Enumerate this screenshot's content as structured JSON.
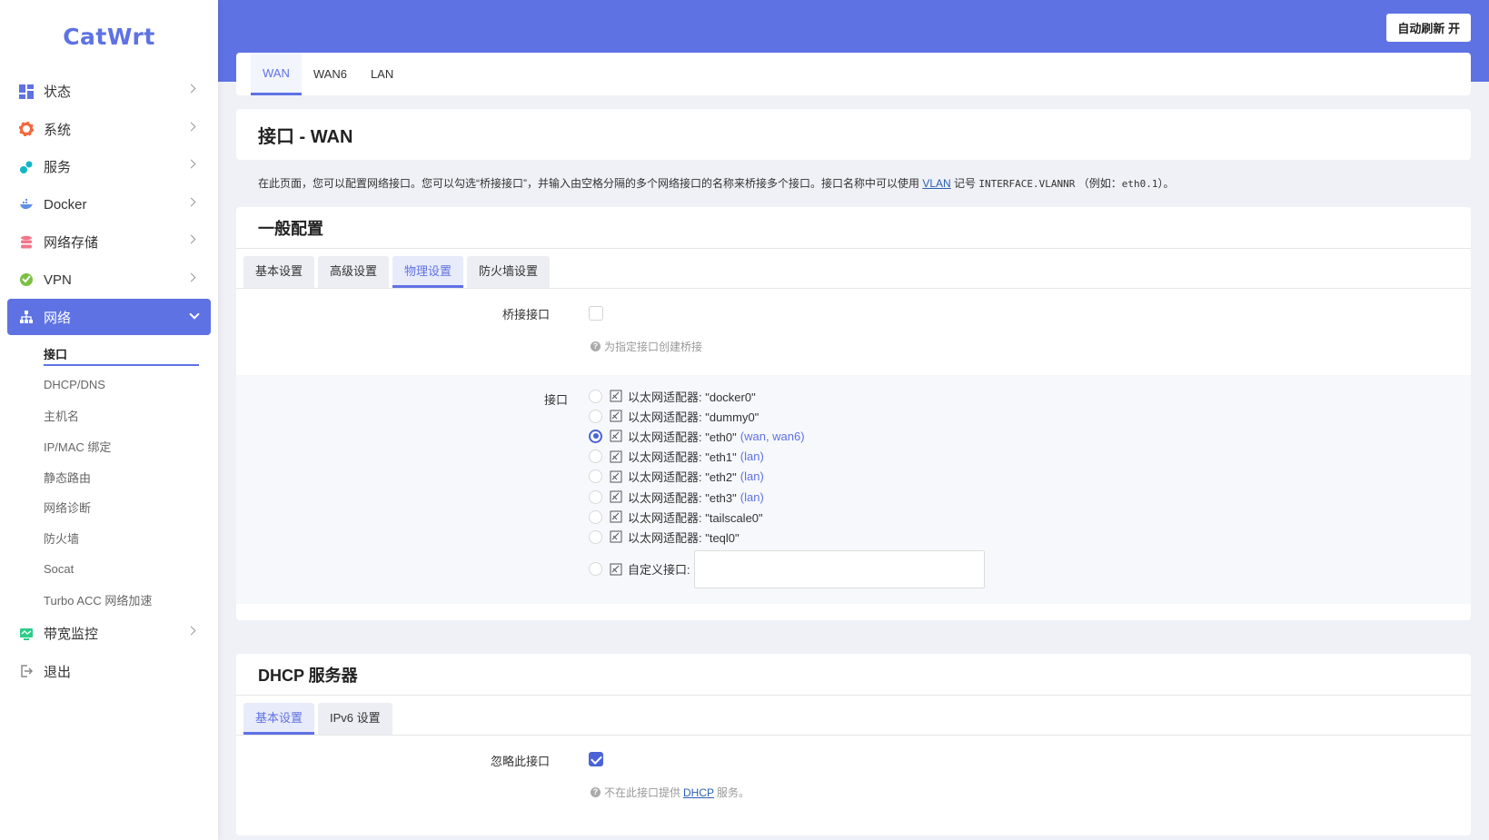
{
  "app": {
    "logo": "CatWrt"
  },
  "header": {
    "refresh_button": "自动刷新 开"
  },
  "sidebar": {
    "items": [
      {
        "label": "状态",
        "icon": "dashboard-icon",
        "color": "#5e72e4"
      },
      {
        "label": "系统",
        "icon": "gear-icon",
        "color": "#f5653b"
      },
      {
        "label": "服务",
        "icon": "puzzle-icon",
        "color": "#11b7c9"
      },
      {
        "label": "Docker",
        "icon": "docker-icon",
        "color": "#5e8fe4"
      },
      {
        "label": "网络存储",
        "icon": "storage-icon",
        "color": "#f2768a"
      },
      {
        "label": "VPN",
        "icon": "vpn-icon",
        "color": "#7bc043"
      },
      {
        "label": "网络",
        "icon": "network-icon",
        "color": "#ffffff"
      },
      {
        "label": "带宽监控",
        "icon": "monitor-icon",
        "color": "#2dce89"
      },
      {
        "label": "退出",
        "icon": "logout-icon",
        "color": "#888888"
      }
    ],
    "submenu": [
      "接口",
      "DHCP/DNS",
      "主机名",
      "IP/MAC 绑定",
      "静态路由",
      "网络诊断",
      "防火墙",
      "Socat",
      "Turbo ACC 网络加速"
    ]
  },
  "top_tabs": [
    "WAN",
    "WAN6",
    "LAN"
  ],
  "page": {
    "title": "接口 - WAN",
    "description_pre": "在此页面，您可以配置网络接口。您可以勾选“桥接接口”，并输入由空格分隔的多个网络接口的名称来桥接多个接口。接口名称中可以使用",
    "description_link": "VLAN",
    "description_mid": "记号",
    "description_code": "INTERFACE.VLANNR",
    "description_post": "（例如：",
    "description_example": "eth0.1",
    "description_end": "）。"
  },
  "general": {
    "title": "一般配置",
    "tabs": [
      "基本设置",
      "高级设置",
      "物理设置",
      "防火墙设置"
    ],
    "bridge_label": "桥接接口",
    "bridge_hint": "为指定接口创建桥接",
    "iface_label": "接口",
    "interfaces": [
      {
        "name": "以太网适配器: \"docker0\"",
        "zone": ""
      },
      {
        "name": "以太网适配器: \"dummy0\"",
        "zone": ""
      },
      {
        "name": "以太网适配器: \"eth0\"",
        "zone": "(wan, wan6)"
      },
      {
        "name": "以太网适配器: \"eth1\"",
        "zone": "(lan)"
      },
      {
        "name": "以太网适配器: \"eth2\"",
        "zone": "(lan)"
      },
      {
        "name": "以太网适配器: \"eth3\"",
        "zone": "(lan)"
      },
      {
        "name": "以太网适配器: \"tailscale0\"",
        "zone": ""
      },
      {
        "name": "以太网适配器: \"teql0\"",
        "zone": ""
      }
    ],
    "custom_label": "自定义接口:",
    "custom_value": ""
  },
  "dhcp": {
    "title": "DHCP 服务器",
    "tabs": [
      "基本设置",
      "IPv6 设置"
    ],
    "ignore_label": "忽略此接口",
    "hint_pre": "不在此接口提供",
    "hint_link": "DHCP",
    "hint_post": "服务。"
  }
}
